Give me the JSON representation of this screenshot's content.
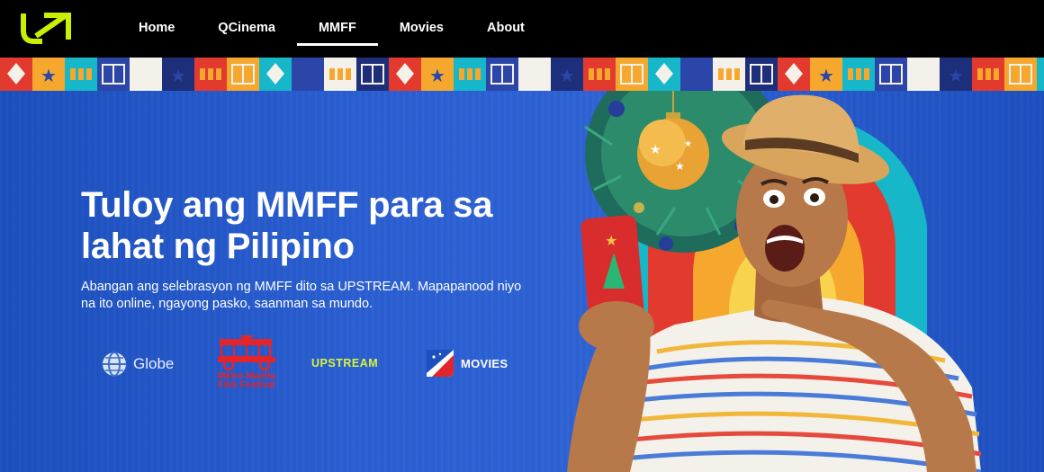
{
  "nav": {
    "items": [
      {
        "label": "Home",
        "active": false
      },
      {
        "label": "QCinema",
        "active": false
      },
      {
        "label": "MMFF",
        "active": true
      },
      {
        "label": "Movies",
        "active": false
      },
      {
        "label": "About",
        "active": false
      }
    ]
  },
  "hero": {
    "title": "Tuloy ang MMFF para sa lahat ng Pilipino",
    "subtitle": "Abangan ang selebrasyon ng MMFF dito sa UPSTREAM. Mapapanood niyo na ito online, ngayong pasko, saanman sa mundo."
  },
  "partners": {
    "globe": "Globe",
    "mmff_line1": "Metro Manila",
    "mmff_line2": "Film Festival",
    "upstream": "UPSTREAM",
    "qmovies": "MOVIES"
  },
  "colors": {
    "accent": "#c8f000",
    "hero_blue": "#2a5ed1",
    "nav_bg": "#000000"
  },
  "icons": {
    "logo": "upstream-arrow-logo",
    "globe": "globe-logo-icon",
    "mmff": "mmff-jeepney-logo",
    "qmovies": "qmovies-logo-icon"
  }
}
